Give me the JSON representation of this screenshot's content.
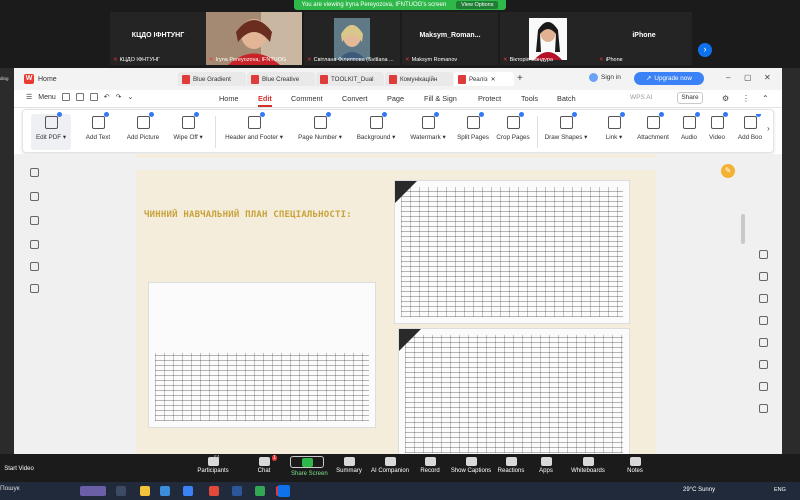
{
  "zoom": {
    "banner_text": "You are viewing Iryna Pereyozova, IFNTUOG's screen",
    "view_options": "View Options",
    "participants": [
      {
        "big_label": "КЦДО ІФНТУНГ",
        "name": "КЦДО ІФНТУНГ",
        "type": "text"
      },
      {
        "big_label": "",
        "name": "Iryna Pereyozova, IFNTUOG",
        "type": "video"
      },
      {
        "big_label": "",
        "name": "Світлана Філиппова (Svitlana ...",
        "type": "video"
      },
      {
        "big_label": "Maksym_Roman...",
        "name": "Maksym Romanov",
        "type": "text"
      },
      {
        "big_label": "",
        "name": "Вікторія Бандура",
        "type": "video"
      },
      {
        "big_label": "iPhone",
        "name": "iPhone",
        "type": "text"
      }
    ],
    "controls": {
      "start_video": "Start Video",
      "participants": "Participants",
      "participants_count": "64",
      "chat": "Chat",
      "chat_badge": "1",
      "share_screen": "Share Screen",
      "summary": "Summary",
      "ai_companion": "AI Companion",
      "record": "Record",
      "show_captions": "Show Captions",
      "reactions": "Reactions",
      "apps": "Apps",
      "whiteboards": "Whiteboards",
      "notes": "Notes"
    }
  },
  "wps": {
    "home_tab": "Home",
    "tabs": [
      "Blue Gradient",
      "Blue Creative",
      "TOOLKIT_Dual",
      "Комунікаційн",
      "Реаліз"
    ],
    "sign_in": "Sign in",
    "upgrade": "Upgrade now",
    "menu": {
      "menu_label": "Menu",
      "items": [
        "Home",
        "Edit",
        "Comment",
        "Convert",
        "Page",
        "Fill & Sign",
        "Protect",
        "Tools",
        "Batch"
      ],
      "active": "Edit",
      "wps_ai": "WPS AI",
      "share": "Share"
    },
    "toolbar": [
      "Edit PDF",
      "Add Text",
      "Add Picture",
      "Wipe Off",
      "Header and Footer",
      "Page Number",
      "Background",
      "Watermark",
      "Split Pages",
      "Crop Pages",
      "Draw Shapes",
      "Link",
      "Attachment",
      "Audio",
      "Video",
      "Add Boo"
    ],
    "slide_title": "ЧИННИЙ НАВЧАЛЬНИЙ ПЛАН СПЕЦІАЛЬНОСТІ:"
  },
  "taskbar": {
    "search": "Пошук",
    "weather": "29°C  Sunny",
    "lang": "ENG"
  }
}
